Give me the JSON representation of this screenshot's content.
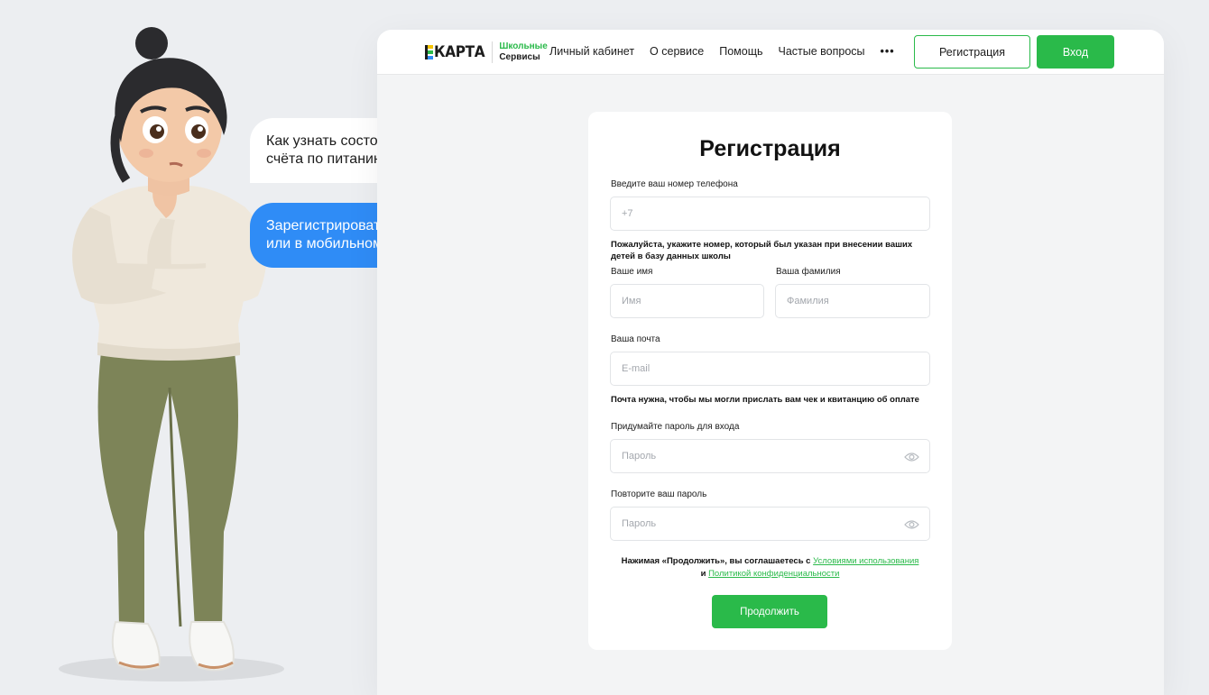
{
  "chat": {
    "question": "Как узнать состояние лицевого счёта по питанию в школе?",
    "answer": "Зарегистрироваться на сайте или в мобильном приложении"
  },
  "header": {
    "logo_text": "КАРТА",
    "logo_line1": "Школьные",
    "logo_line2": "Сервисы",
    "nav": [
      "Личный кабинет",
      "О сервисе",
      "Помощь",
      "Частые вопросы"
    ],
    "more": "•••",
    "register_label": "Регистрация",
    "login_label": "Вход"
  },
  "form": {
    "title": "Регистрация",
    "phone_label": "Введите ваш номер телефона",
    "phone_placeholder": "+7",
    "phone_hint": "Пожалуйста, укажите номер, который был указан при внесении ваших детей в базу данных школы",
    "first_name_label": "Ваше имя",
    "first_name_placeholder": "Имя",
    "last_name_label": "Ваша фамилия",
    "last_name_placeholder": "Фамилия",
    "email_label": "Ваша почта",
    "email_placeholder": "E-mail",
    "email_hint": "Почта нужна, чтобы мы могли прислать вам чек и квитанцию об оплате",
    "password_label": "Придумайте пароль для входа",
    "password_placeholder": "Пароль",
    "password_repeat_label": "Повторите ваш пароль",
    "password_repeat_placeholder": "Пароль",
    "consent_prefix": "Нажимая «Продолжить», вы соглашаетесь с ",
    "terms_link": "Условиями использования",
    "consent_and": "и ",
    "privacy_link": "Политикой конфиденциальности",
    "continue_label": "Продолжить"
  },
  "icons": {
    "eye": "eye-icon",
    "more": "more-dots-icon"
  },
  "colors": {
    "accent_green": "#2aba4a",
    "bubble_blue": "#2f8cf6",
    "logo_yellow": "#f5c400"
  }
}
